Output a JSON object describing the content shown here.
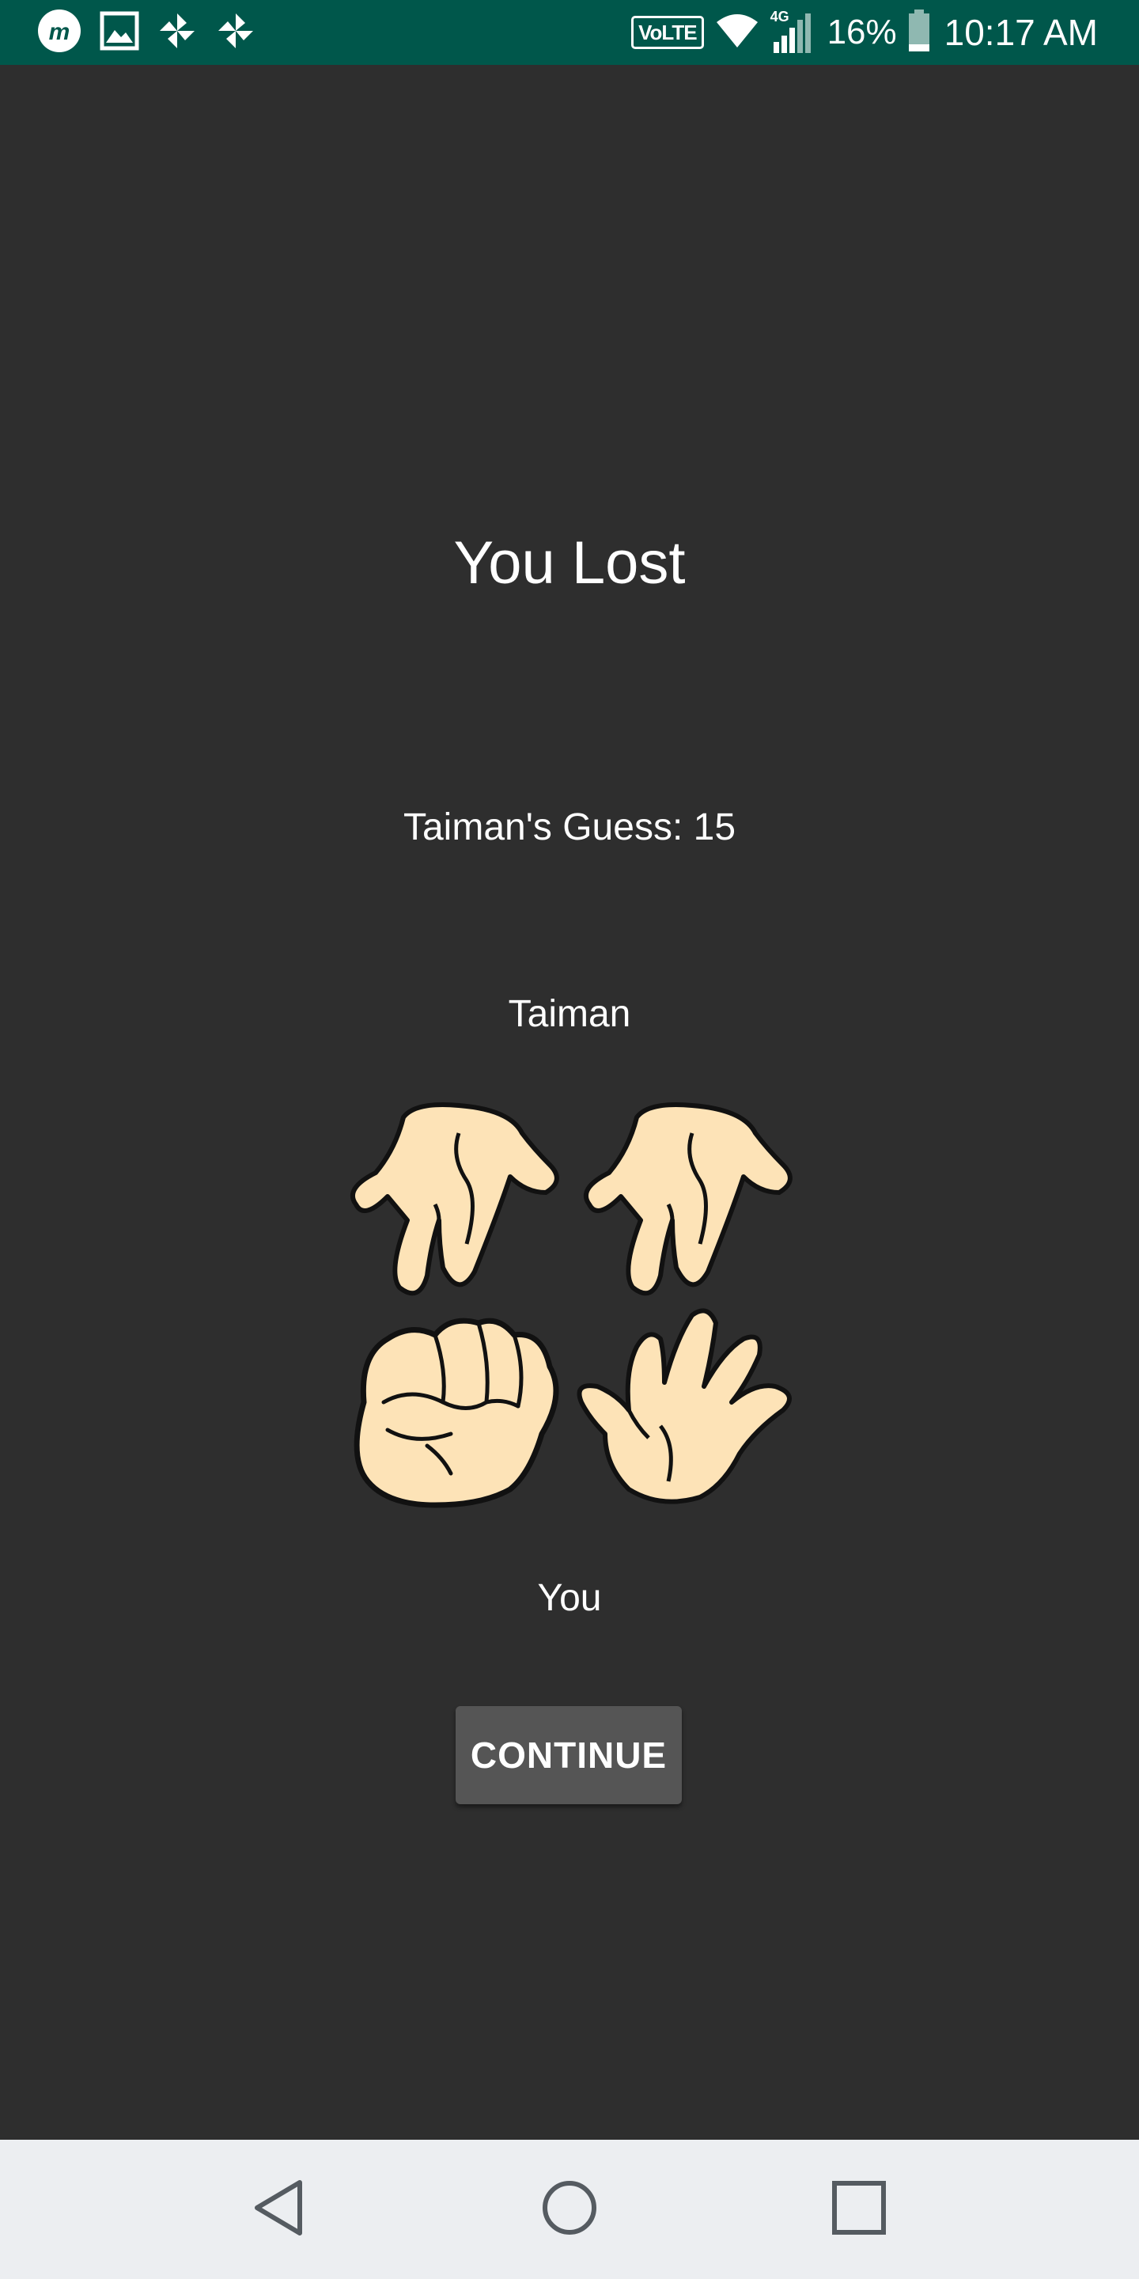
{
  "status_bar": {
    "left_icons": [
      "messenger-icon",
      "gallery-icon",
      "pinwheel-icon",
      "pinwheel-icon"
    ],
    "volte_label": "VoLTE",
    "network_label": "4G",
    "battery_percent": "16%",
    "time": "10:17 AM",
    "background": "#00574b"
  },
  "result": {
    "title": "You Lost",
    "guess_text": "Taiman's Guess: 15",
    "opponent_name": "Taiman",
    "player_name": "You"
  },
  "hands": {
    "opponent": [
      "open-hand-icon",
      "open-hand-icon"
    ],
    "player": [
      "fist-icon",
      "open-hand-icon"
    ],
    "skin_color": "#fde3b7"
  },
  "actions": {
    "continue_label": "CONTINUE"
  },
  "nav_bar": {
    "buttons": [
      "back-icon",
      "home-icon",
      "recents-icon"
    ]
  },
  "colors": {
    "background": "#2e2e2e",
    "button": "#555555",
    "text": "#ffffff"
  }
}
